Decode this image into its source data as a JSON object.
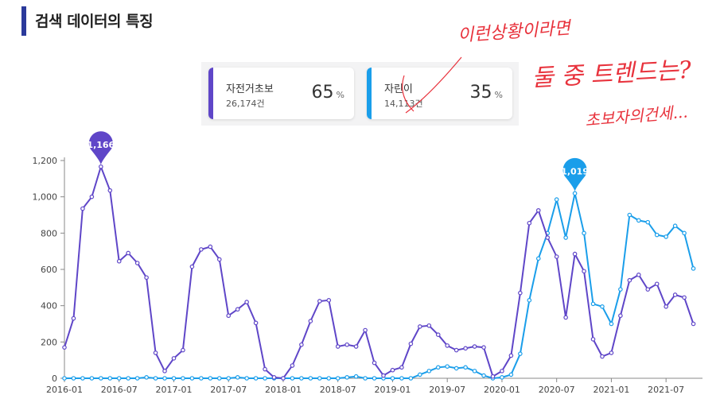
{
  "header": {
    "title": "검색 데이터의 특징"
  },
  "legend": [
    {
      "name": "자전거초보",
      "count": "26,174건",
      "percent": "65",
      "unit": "%",
      "color": "#5f46c8"
    },
    {
      "name": "자린이",
      "count": "14,113건",
      "percent": "35",
      "unit": "%",
      "color": "#1a9eea"
    }
  ],
  "annotations": {
    "line1": "이런상황이라면",
    "line2": "둘 중 트렌드는?",
    "line3": "초보자의건세..."
  },
  "chart_data": {
    "type": "line",
    "x": [
      "2016-01",
      "2016-02",
      "2016-03",
      "2016-04",
      "2016-05",
      "2016-06",
      "2016-07",
      "2016-08",
      "2016-09",
      "2016-10",
      "2016-11",
      "2016-12",
      "2017-01",
      "2017-02",
      "2017-03",
      "2017-04",
      "2017-05",
      "2017-06",
      "2017-07",
      "2017-08",
      "2017-09",
      "2017-10",
      "2017-11",
      "2017-12",
      "2018-01",
      "2018-02",
      "2018-03",
      "2018-04",
      "2018-05",
      "2018-06",
      "2018-07",
      "2018-08",
      "2018-09",
      "2018-10",
      "2018-11",
      "2018-12",
      "2019-01",
      "2019-02",
      "2019-03",
      "2019-04",
      "2019-05",
      "2019-06",
      "2019-07",
      "2019-08",
      "2019-09",
      "2019-10",
      "2019-11",
      "2019-12",
      "2020-01",
      "2020-02",
      "2020-03",
      "2020-04",
      "2020-05",
      "2020-06",
      "2020-07",
      "2020-08",
      "2020-09",
      "2020-10",
      "2020-11",
      "2020-12",
      "2021-01",
      "2021-02",
      "2021-03",
      "2021-04",
      "2021-05",
      "2021-06",
      "2021-07",
      "2021-08",
      "2021-09",
      "2021-10",
      "2021-11"
    ],
    "xticks": [
      "2016-01",
      "2016-07",
      "2017-01",
      "2017-07",
      "2018-01",
      "2018-07",
      "2019-01",
      "2019-07",
      "2020-01",
      "2020-07",
      "2021-01",
      "2021-07"
    ],
    "ylim": [
      0,
      1200
    ],
    "yticks": [
      "0",
      "200",
      "400",
      "600",
      "800",
      "1,000",
      "1,200"
    ],
    "series": [
      {
        "name": "자전거초보",
        "color": "#5f46c8",
        "values": [
          170,
          330,
          935,
          1000,
          1166,
          1035,
          645,
          690,
          635,
          555,
          140,
          40,
          110,
          155,
          615,
          710,
          725,
          655,
          345,
          380,
          420,
          305,
          50,
          5,
          0,
          70,
          185,
          315,
          425,
          430,
          175,
          185,
          175,
          265,
          85,
          15,
          45,
          60,
          190,
          285,
          290,
          240,
          180,
          155,
          165,
          175,
          170,
          10,
          40,
          125,
          470,
          855,
          925,
          775,
          670,
          335,
          685,
          590,
          215,
          120,
          140,
          345,
          540,
          570,
          490,
          520,
          395,
          460,
          445,
          300,
          null
        ],
        "peak_label": "1,166"
      },
      {
        "name": "자린이",
        "color": "#1a9eea",
        "values": [
          0,
          0,
          0,
          0,
          0,
          0,
          0,
          0,
          0,
          5,
          0,
          0,
          0,
          0,
          0,
          0,
          0,
          0,
          0,
          5,
          0,
          0,
          0,
          0,
          0,
          0,
          0,
          0,
          0,
          0,
          0,
          5,
          10,
          0,
          0,
          0,
          0,
          0,
          0,
          20,
          40,
          60,
          65,
          55,
          60,
          40,
          15,
          0,
          5,
          20,
          135,
          430,
          660,
          800,
          985,
          775,
          1019,
          800,
          410,
          395,
          300,
          490,
          900,
          870,
          860,
          790,
          780,
          840,
          800,
          605,
          null
        ],
        "peak_label": "1,019"
      }
    ]
  }
}
